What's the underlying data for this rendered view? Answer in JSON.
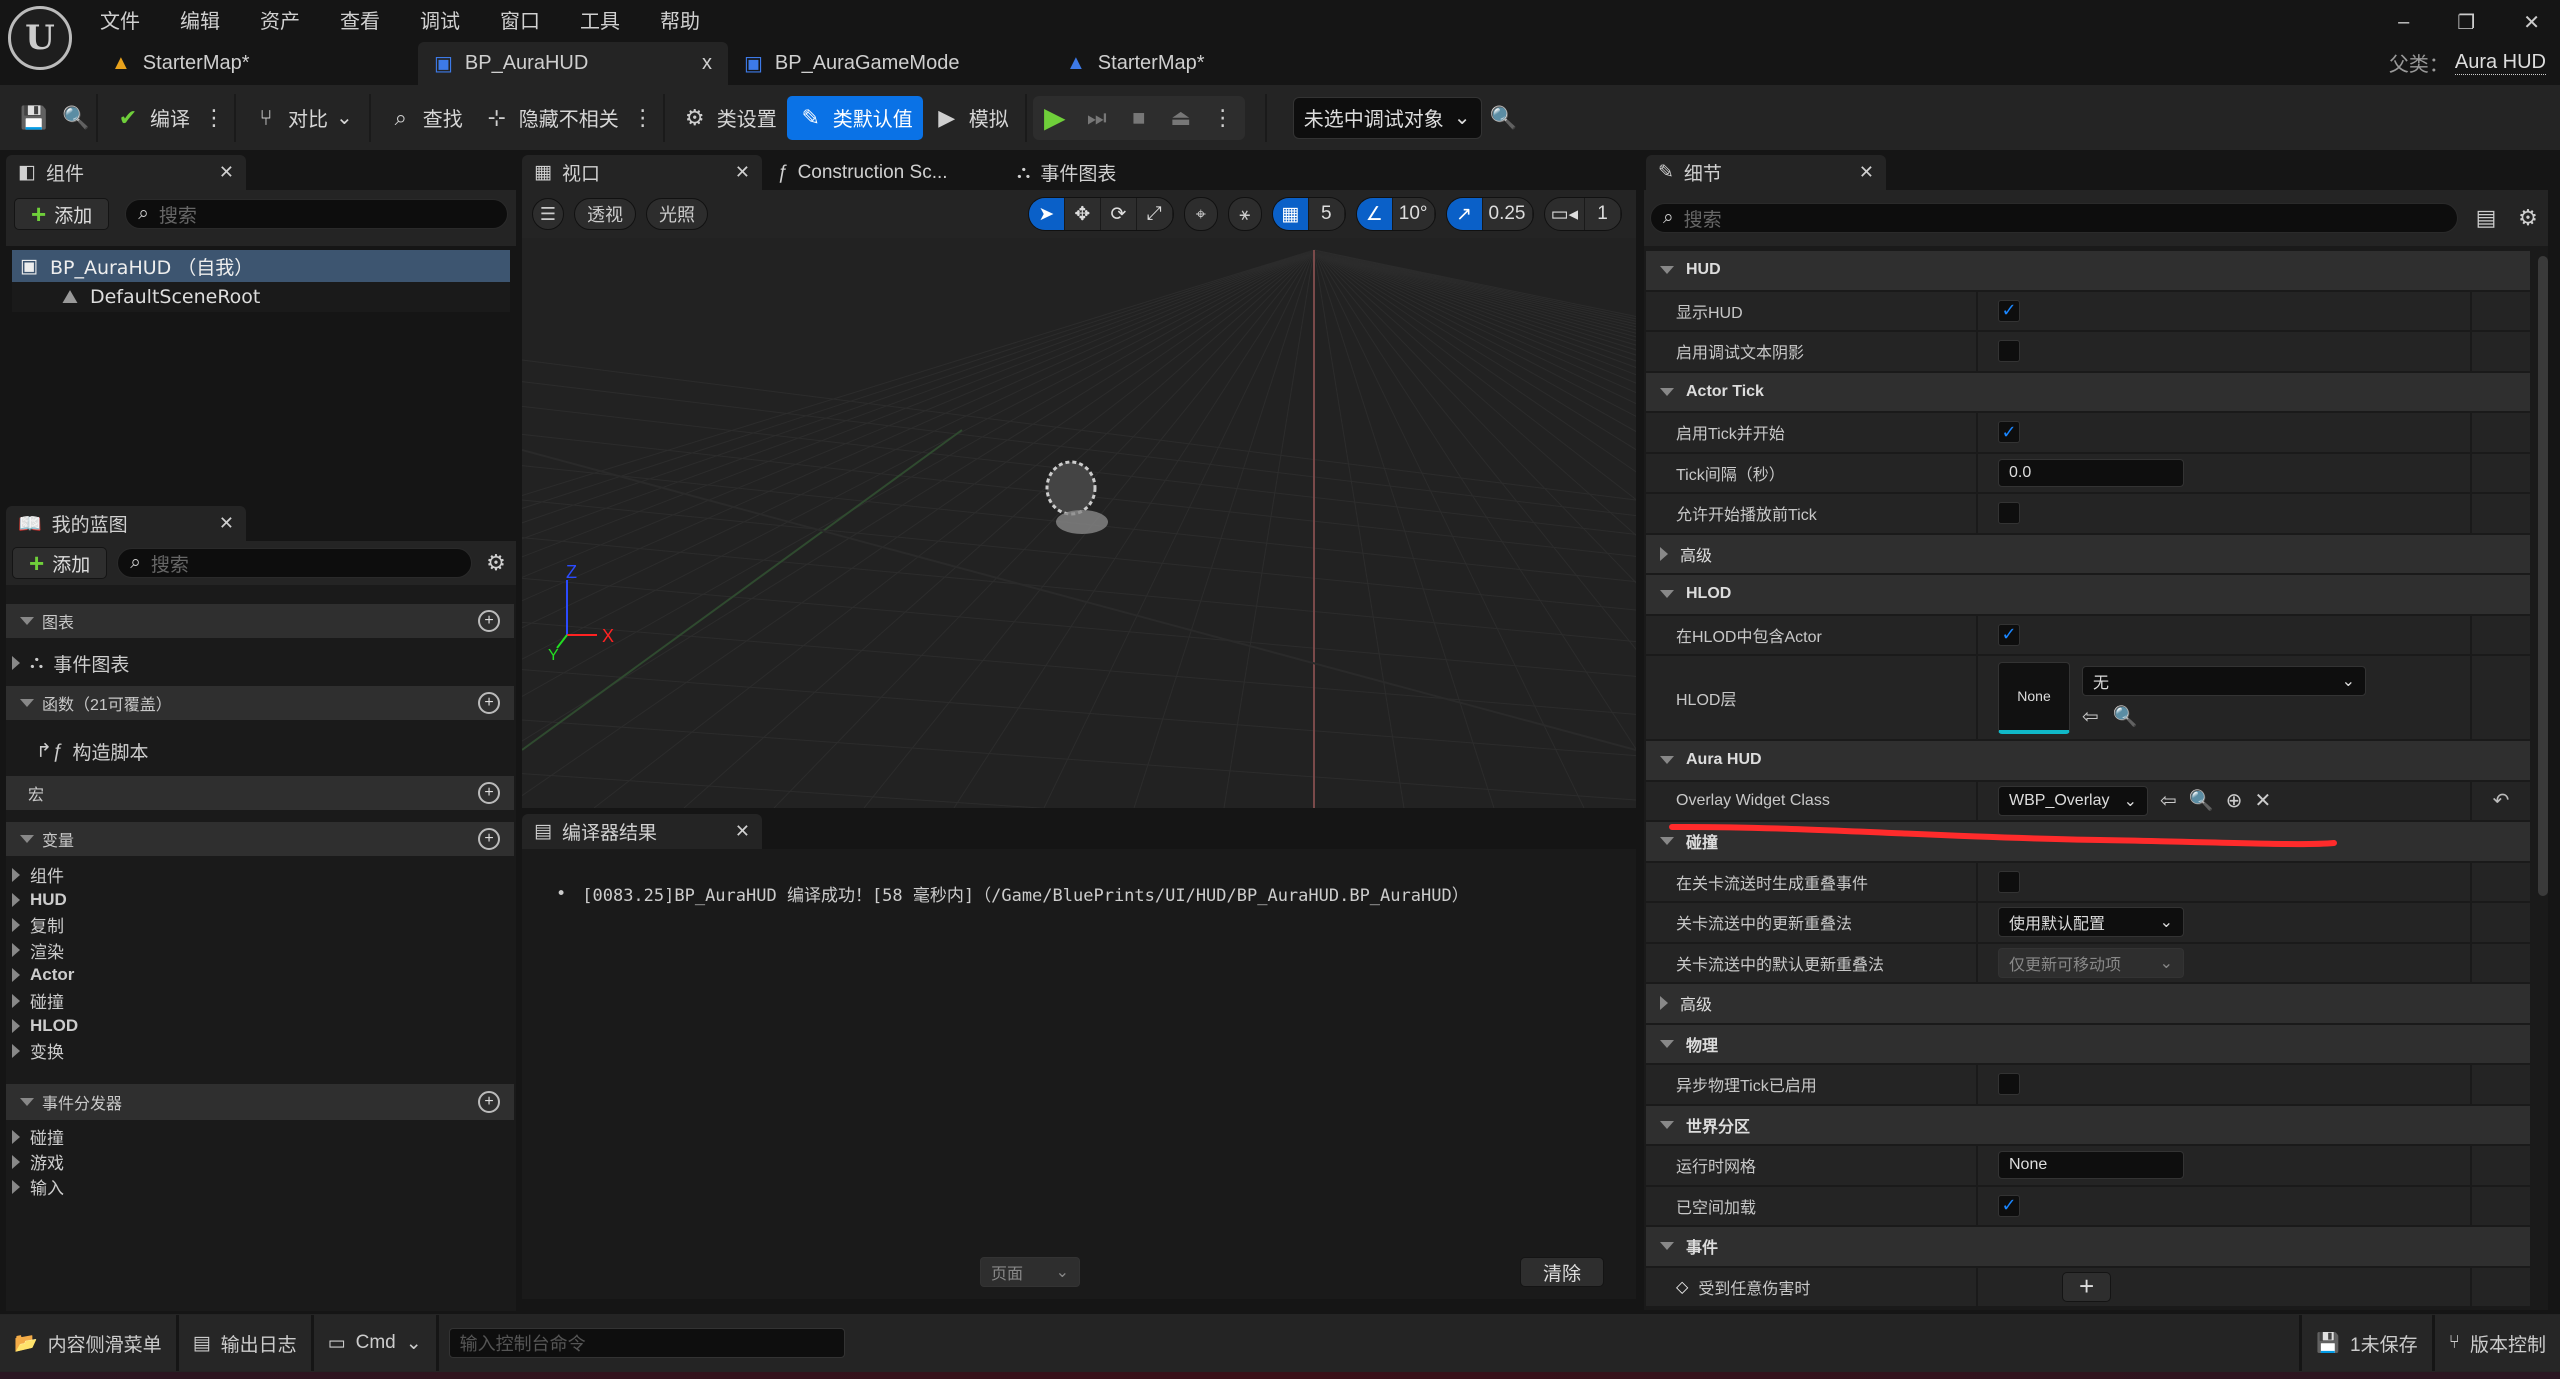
{
  "menu": [
    "文件",
    "编辑",
    "资产",
    "查看",
    "调试",
    "窗口",
    "工具",
    "帮助"
  ],
  "doc_tabs": [
    {
      "label": "StarterMap*",
      "icon": "level-icon",
      "color": "#e8a21c"
    },
    {
      "label": "BP_AuraHUD",
      "icon": "hud-blueprint-icon",
      "color": "#3d7ae8",
      "active": true,
      "close": "x"
    },
    {
      "label": "BP_AuraGameMode",
      "icon": "gamemode-blueprint-icon",
      "color": "#3d7ae8"
    },
    {
      "label": "StarterMap*",
      "icon": "level-icon",
      "color": "#3d7ae8"
    }
  ],
  "parent_class": {
    "label": "父类：",
    "value": "Aura HUD"
  },
  "window_controls": {
    "min": "–",
    "max": "❐",
    "close": "✕"
  },
  "toolbar": {
    "compile": "编译",
    "diff": "对比",
    "find": "查找",
    "hide_unrelated": "隐藏不相关",
    "class_settings": "类设置",
    "class_defaults": "类默认值",
    "simulate": "模拟",
    "debug_target": "未选中调试对象"
  },
  "components": {
    "tab": "组件",
    "add": "添加",
    "search_placeholder": "搜索",
    "tree": [
      "BP_AuraHUD （自我）",
      "DefaultSceneRoot"
    ]
  },
  "my_blueprint": {
    "tab": "我的蓝图",
    "add": "添加",
    "search_placeholder": "搜索",
    "graphs": "图表",
    "event_graph": "事件图表",
    "functions": "函数（21可覆盖）",
    "construction_script": "构造脚本",
    "macros": "宏",
    "variables": "变量",
    "variable_categories": [
      "组件",
      "HUD",
      "复制",
      "渲染",
      "Actor",
      "碰撞",
      "HLOD",
      "变换"
    ],
    "dispatchers": "事件分发器",
    "dispatcher_categories": [
      "碰撞",
      "游戏",
      "输入"
    ]
  },
  "viewport": {
    "tab": "视口",
    "tab2": "Construction Sc...",
    "tab3": "事件图表",
    "perspective": "透视",
    "lighting": "光照",
    "grid_snap": "5",
    "rotation_snap": "10°",
    "scale_snap": "0.25",
    "camera_speed": "1",
    "axis": {
      "z": "Z",
      "x": "X",
      "y": "Y"
    }
  },
  "compiler": {
    "tab": "编译器结果",
    "message": "[0083.25]BP_AuraHUD 编译成功！[58 毫秒内]（/Game/BluePrints/UI/HUD/BP_AuraHUD.BP_AuraHUD）",
    "page": "页面",
    "clear": "清除"
  },
  "details": {
    "tab": "细节",
    "search_placeholder": "搜索",
    "rows": [
      {
        "t": "s",
        "label": "HUD"
      },
      {
        "t": "p",
        "label": "显示HUD",
        "kind": "checkbox",
        "checked": true
      },
      {
        "t": "p",
        "label": "启用调试文本阴影",
        "kind": "checkbox",
        "checked": false
      },
      {
        "t": "s",
        "label": "Actor Tick"
      },
      {
        "t": "p",
        "label": "启用Tick并开始",
        "kind": "checkbox",
        "checked": true
      },
      {
        "t": "p",
        "label": "Tick间隔（秒）",
        "kind": "text",
        "value": "0.0"
      },
      {
        "t": "p",
        "label": "允许开始播放前Tick",
        "kind": "checkbox",
        "checked": false
      },
      {
        "t": "c",
        "label": "高级"
      },
      {
        "t": "s",
        "label": "HLOD"
      },
      {
        "t": "p",
        "label": "在HLOD中包含Actor",
        "kind": "checkbox",
        "checked": true
      },
      {
        "t": "p",
        "label": "HLOD层",
        "kind": "asset",
        "thumb": "None",
        "value": "无",
        "tall": true
      },
      {
        "t": "s",
        "label": "Aura HUD"
      },
      {
        "t": "p",
        "label": "Overlay Widget Class",
        "kind": "class",
        "value": "WBP_Overlay",
        "reset": true
      },
      {
        "t": "s",
        "label": "碰撞"
      },
      {
        "t": "p",
        "label": "在关卡流送时生成重叠事件",
        "kind": "checkbox",
        "checked": false
      },
      {
        "t": "p",
        "label": "关卡流送中的更新重叠法",
        "kind": "select",
        "value": "使用默认配置"
      },
      {
        "t": "p",
        "label": "关卡流送中的默认更新重叠法",
        "kind": "select",
        "value": "仅更新可移动项",
        "disabled": true
      },
      {
        "t": "c",
        "label": "高级"
      },
      {
        "t": "s",
        "label": "物理"
      },
      {
        "t": "p",
        "label": "异步物理Tick已启用",
        "kind": "checkbox",
        "checked": false
      },
      {
        "t": "s",
        "label": "世界分区"
      },
      {
        "t": "p",
        "label": "运行时网格",
        "kind": "text",
        "value": "None"
      },
      {
        "t": "p",
        "label": "已空间加载",
        "kind": "checkbox",
        "checked": true
      },
      {
        "t": "s",
        "label": "事件"
      },
      {
        "t": "p",
        "label": "受到任意伤害时",
        "kind": "event",
        "value": "+"
      }
    ]
  },
  "status": {
    "content_drawer": "内容侧滑菜单",
    "output_log": "输出日志",
    "cmd": "Cmd",
    "console_placeholder": "输入控制台命令",
    "unsaved": "1未保存",
    "source_control": "版本控制"
  },
  "colors": {
    "accent": "#0a72e6",
    "annotation": "#ff2b2b",
    "play": "#6fcf3a"
  }
}
